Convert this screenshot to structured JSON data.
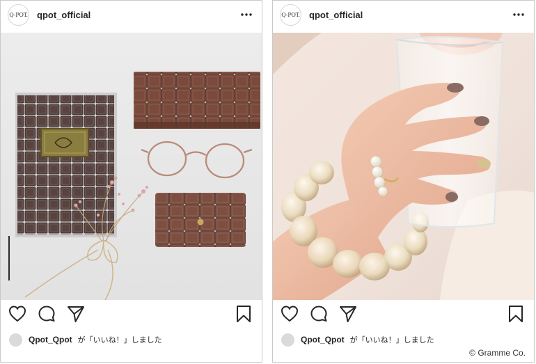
{
  "posts": [
    {
      "avatar_text": "Q-POT.",
      "username": "qpot_official",
      "liker": "Qpot_Qpot",
      "likes_text": "が「いいね！」しました",
      "photo": "chocolate-bar design notebook, eyewear case, glasses and key case with dried flowers"
    },
    {
      "avatar_text": "Q-POT.",
      "username": "qpot_official",
      "liker": "Qpot_Qpot",
      "likes_text": "が「いいね！」しました",
      "photo": "hand holding a glass with pearl ring and clear bubble bracelet"
    }
  ],
  "credit": "© Gramme Co.",
  "icons": [
    "more-icon",
    "heart-icon",
    "comment-icon",
    "share-icon",
    "bookmark-icon"
  ]
}
